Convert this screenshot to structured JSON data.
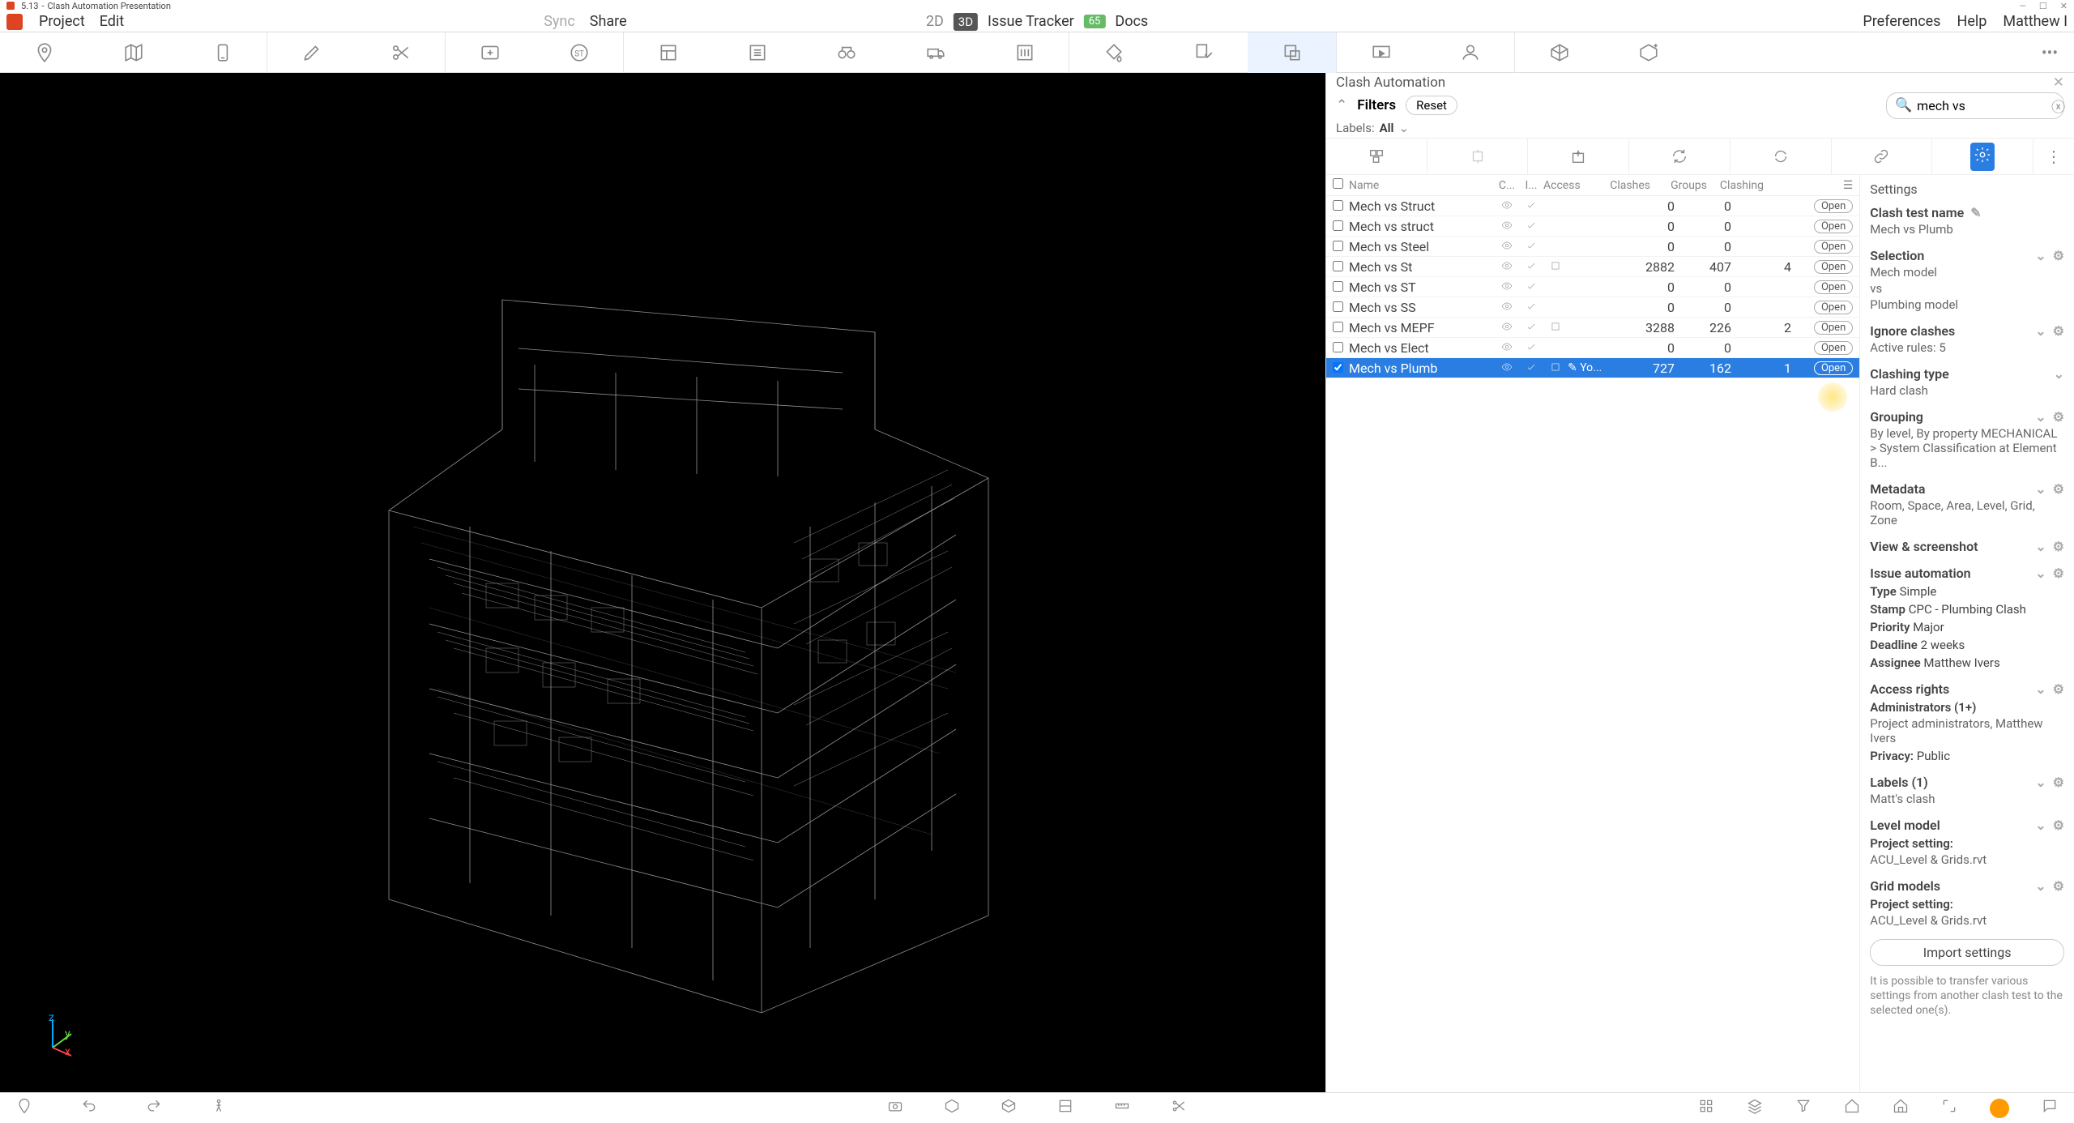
{
  "titlebar": {
    "version": "5.13",
    "title": "Clash Automation Presentation"
  },
  "menubar": {
    "project": "Project",
    "edit": "Edit",
    "sync": "Sync",
    "share": "Share",
    "view2d": "2D",
    "view3d": "3D",
    "issue_tracker": "Issue Tracker",
    "badge": "65",
    "docs": "Docs",
    "preferences": "Preferences",
    "help": "Help",
    "user": "Matthew I"
  },
  "panel": {
    "title": "Clash Automation",
    "filters_label": "Filters",
    "reset": "Reset",
    "labels_label": "Labels:",
    "labels_value": "All",
    "search_value": "mech vs",
    "settings_label": "Settings"
  },
  "table": {
    "headers": {
      "name": "Name",
      "c": "C...",
      "i": "I...",
      "access": "Access",
      "clashes": "Clashes",
      "groups": "Groups",
      "clashing": "Clashing"
    },
    "open_label": "Open",
    "rows": [
      {
        "name": "Mech vs Struct",
        "eye": true,
        "check": true,
        "clashes": "0",
        "groups": "0",
        "clashing": ""
      },
      {
        "name": "Mech vs struct",
        "eye": true,
        "check": true,
        "clashes": "0",
        "groups": "0",
        "clashing": ""
      },
      {
        "name": "Mech vs Steel",
        "eye": true,
        "check": true,
        "clashes": "0",
        "groups": "0",
        "clashing": ""
      },
      {
        "name": "Mech vs St",
        "eye": true,
        "check": true,
        "extra": true,
        "clashes": "2882",
        "groups": "407",
        "clashing": "4"
      },
      {
        "name": "Mech vs ST",
        "eye": true,
        "check": true,
        "clashes": "0",
        "groups": "0",
        "clashing": ""
      },
      {
        "name": "Mech vs SS",
        "eye": true,
        "check": true,
        "clashes": "0",
        "groups": "0",
        "clashing": ""
      },
      {
        "name": "Mech vs MEPF",
        "eye": true,
        "check": true,
        "extra": true,
        "clashes": "3288",
        "groups": "226",
        "clashing": "2"
      },
      {
        "name": "Mech vs Elect",
        "eye": true,
        "check": true,
        "clashes": "0",
        "groups": "0",
        "clashing": ""
      },
      {
        "name": "Mech vs Plumb",
        "eye": true,
        "check": true,
        "extra": true,
        "access": "Yo...",
        "clashes": "727",
        "groups": "162",
        "clashing": "1",
        "selected": true
      }
    ]
  },
  "settings": {
    "clash_test_name": {
      "label": "Clash test name",
      "value": "Mech vs Plumb"
    },
    "selection": {
      "label": "Selection",
      "line1": "Mech model",
      "line2": "vs",
      "line3": "Plumbing model"
    },
    "ignore": {
      "label": "Ignore clashes",
      "value": "Active rules: 5"
    },
    "clashing_type": {
      "label": "Clashing type",
      "value": "Hard clash"
    },
    "grouping": {
      "label": "Grouping",
      "value": "By level, By property MECHANICAL > System Classification at Element B..."
    },
    "metadata": {
      "label": "Metadata",
      "value": "Room, Space, Area, Level, Grid, Zone"
    },
    "view": {
      "label": "View & screenshot"
    },
    "issue_auto": {
      "label": "Issue automation",
      "type_k": "Type",
      "type_v": "Simple",
      "stamp_k": "Stamp",
      "stamp_v": "CPC - Plumbing Clash",
      "priority_k": "Priority",
      "priority_v": "Major",
      "deadline_k": "Deadline",
      "deadline_v": "2 weeks",
      "assignee_k": "Assignee",
      "assignee_v": "Matthew Ivers"
    },
    "access": {
      "label": "Access rights",
      "admins_k": "Administrators (1+)",
      "admins_v": "Project administrators, Matthew Ivers",
      "privacy_k": "Privacy:",
      "privacy_v": "Public"
    },
    "labels": {
      "label": "Labels (1)",
      "value": "Matt's clash"
    },
    "level_model": {
      "label": "Level model",
      "ps": "Project setting:",
      "file": "ACU_Level & Grids.rvt"
    },
    "grid_models": {
      "label": "Grid models",
      "ps": "Project setting:",
      "file": "ACU_Level & Grids.rvt"
    },
    "import_btn": "Import settings",
    "help": "It is possible to transfer various settings from another clash test to the selected one(s)."
  },
  "chart_data": null
}
